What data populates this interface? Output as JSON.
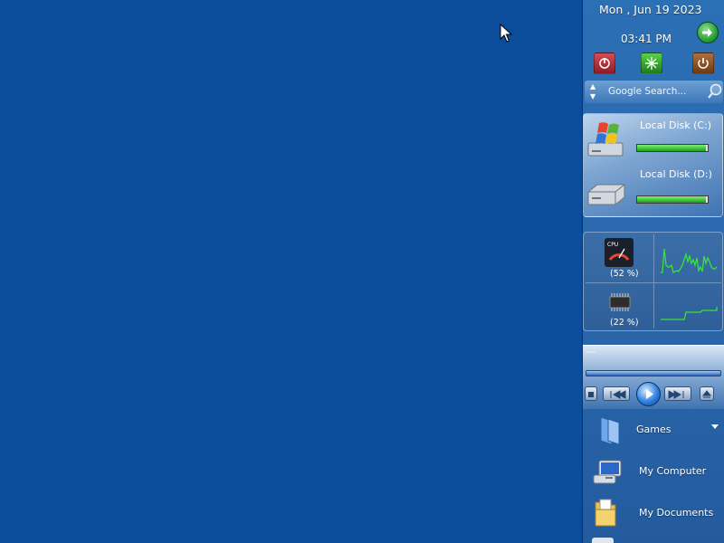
{
  "clock": {
    "date": "Mon , Jun 19 2023",
    "time": "03:41 PM"
  },
  "search": {
    "placeholder": "Google Search..."
  },
  "disks": [
    {
      "label": "Local Disk (C:)",
      "used_fraction": 0.98
    },
    {
      "label": "Local Disk (D:)",
      "used_fraction": 0.98
    }
  ],
  "system": {
    "cpu_percent": "(52 %)",
    "ram_percent": "(22 %)",
    "cpu_icon_text": "CPU"
  },
  "media": {
    "title": "---"
  },
  "menu": [
    {
      "label": "Games"
    },
    {
      "label": "My Computer"
    },
    {
      "label": "My Documents"
    }
  ],
  "colors": {
    "desktop": "#0b4d9b",
    "sidebar": "#2b6fb4",
    "graph_line": "#38e23a"
  },
  "icons": {
    "power": "power-icon",
    "refresh": "refresh-icon",
    "shutdown": "shutdown-icon",
    "go": "go-arrow-icon",
    "search": "magnifier-icon"
  }
}
